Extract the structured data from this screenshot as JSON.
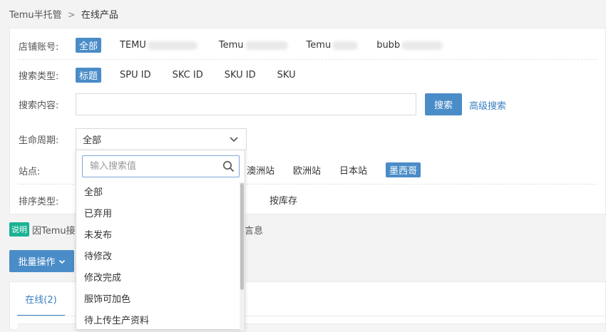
{
  "breadcrumb": {
    "root": "Temu半托管",
    "separator": ">",
    "current": "在线产品"
  },
  "filters": {
    "store": {
      "label": "店铺账号:",
      "options": [
        {
          "label": "全部",
          "active": true
        },
        {
          "label": "TEMU",
          "active": false
        },
        {
          "label": "Temu",
          "active": false
        },
        {
          "label": "Temu",
          "active": false
        },
        {
          "label": "bubb",
          "active": false
        }
      ]
    },
    "search_type": {
      "label": "搜索类型:",
      "options": [
        {
          "label": "标题",
          "active": true
        },
        {
          "label": "SPU ID",
          "active": false
        },
        {
          "label": "SKC ID",
          "active": false
        },
        {
          "label": "SKU ID",
          "active": false
        },
        {
          "label": "SKU",
          "active": false
        }
      ]
    },
    "search_content": {
      "label": "搜索内容:",
      "value": "",
      "search_button": "搜索",
      "advanced_link": "高级搜索"
    },
    "lifecycle": {
      "label": "生命周期:",
      "selected": "全部"
    },
    "site": {
      "label": "站点:",
      "visible_options": [
        {
          "label": "澳洲站",
          "active": false
        },
        {
          "label": "欧洲站",
          "active": false
        },
        {
          "label": "日本站",
          "active": false
        },
        {
          "label": "墨西哥",
          "active": true
        }
      ]
    },
    "sort_type": {
      "label": "排序类型:",
      "visible_options": [
        "按库存"
      ]
    }
  },
  "dropdown": {
    "placeholder": "输入搜索值",
    "items": [
      "全部",
      "已弃用",
      "未发布",
      "待修改",
      "修改完成",
      "服饰可加色",
      "待上传生产资料"
    ]
  },
  "note": {
    "badge": "说明",
    "text_start": "因Temu接",
    "text_end": "言息"
  },
  "batch_button": "批量操作",
  "tabs": [
    {
      "label": "在线(2)",
      "active": true
    }
  ],
  "colors": {
    "primary": "#4a8cc7",
    "link": "#3a7fc1",
    "note_badge": "#1ab394"
  }
}
